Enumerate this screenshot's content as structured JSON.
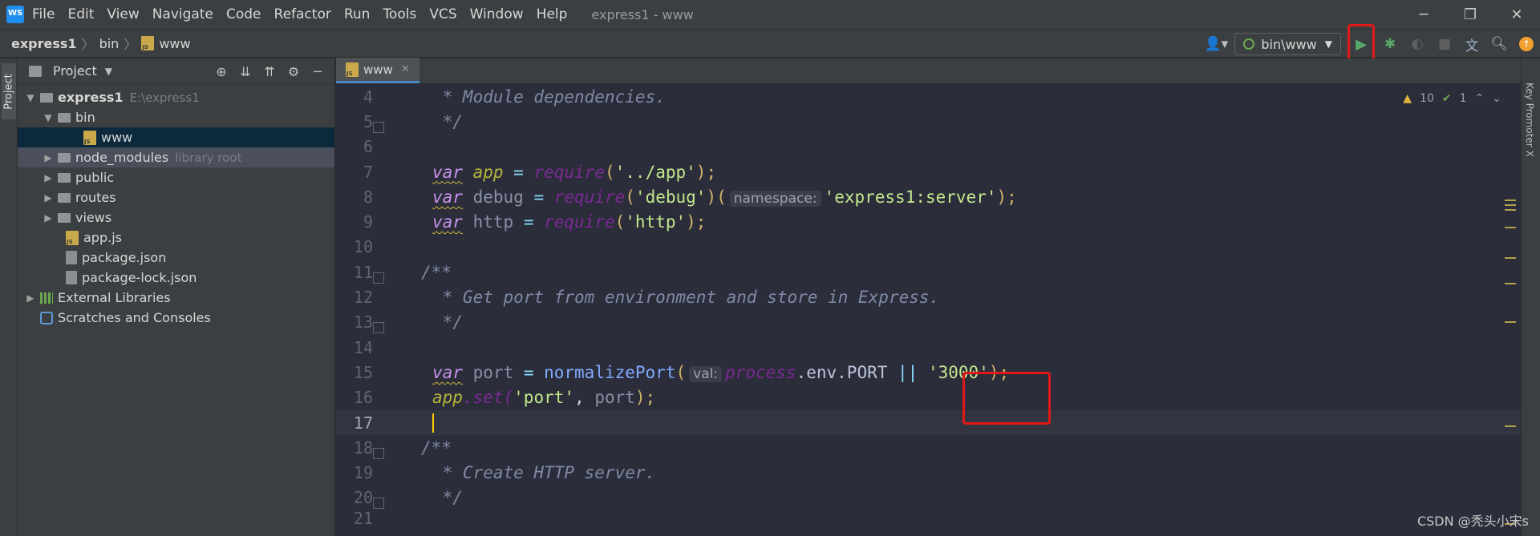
{
  "menu": [
    "File",
    "Edit",
    "View",
    "Navigate",
    "Code",
    "Refactor",
    "Run",
    "Tools",
    "VCS",
    "Window",
    "Help"
  ],
  "window_title": "express1 - www",
  "breadcrumb": [
    "express1",
    "bin",
    "www"
  ],
  "run_config": "bin\\www",
  "project_panel": {
    "title": "Project",
    "tree": [
      {
        "label": "express1",
        "hint": "E:\\express1"
      },
      {
        "label": "bin",
        "hint": ""
      },
      {
        "label": "www",
        "hint": ""
      },
      {
        "label": "node_modules",
        "hint": "library root"
      },
      {
        "label": "public",
        "hint": ""
      },
      {
        "label": "routes",
        "hint": ""
      },
      {
        "label": "views",
        "hint": ""
      },
      {
        "label": "app.js",
        "hint": ""
      },
      {
        "label": "package.json",
        "hint": ""
      },
      {
        "label": "package-lock.json",
        "hint": ""
      },
      {
        "label": "External Libraries",
        "hint": ""
      },
      {
        "label": "Scratches and Consoles",
        "hint": ""
      }
    ]
  },
  "left_tab": "Project",
  "right_tab": "Key Promoter X",
  "editor_tab": "www",
  "inspections": {
    "warnings": "10",
    "ok": "1"
  },
  "code": {
    "lines": [
      "4",
      "5",
      "6",
      "7",
      "8",
      "9",
      "10",
      "11",
      "12",
      "13",
      "14",
      "15",
      "16",
      "17",
      "18",
      "19",
      "20",
      "21"
    ],
    "l4": " * Module dependencies.",
    "l5": " */",
    "l7": {
      "kw": "var",
      "name": "app",
      "eq": " = ",
      "fn": "require",
      "open": "(",
      "str": "'../app'",
      "close": ");"
    },
    "l8": {
      "kw": "var",
      "name": "debug",
      "eq": " = ",
      "fn": "require",
      "open": "(",
      "str": "'debug'",
      "close1": ")(",
      "hint": "namespace:",
      "str2": "'express1:server'",
      "close": ");"
    },
    "l9": {
      "kw": "var",
      "name": "http",
      "eq": " = ",
      "fn": "require",
      "open": "(",
      "str": "'http'",
      "close": ");"
    },
    "l11": "/**",
    "l12": " * Get port from environment and store in Express.",
    "l13": " */",
    "l15": {
      "kw": "var",
      "name": "port",
      "eq": " = ",
      "fn": "normalizePort",
      "open": "(",
      "hint": "val:",
      "proc": "process",
      "rest": ".env.PORT ",
      "or": "||",
      "str": "'3000'",
      "close": ");"
    },
    "l16": {
      "obj": "app",
      "m": ".set(",
      "str": "'port'",
      "sep": ", ",
      "arg": "port",
      "close": ");"
    },
    "l18": "/**",
    "l19": " * Create HTTP server.",
    "l20": " */"
  },
  "watermark": "CSDN @秃头小宋s"
}
